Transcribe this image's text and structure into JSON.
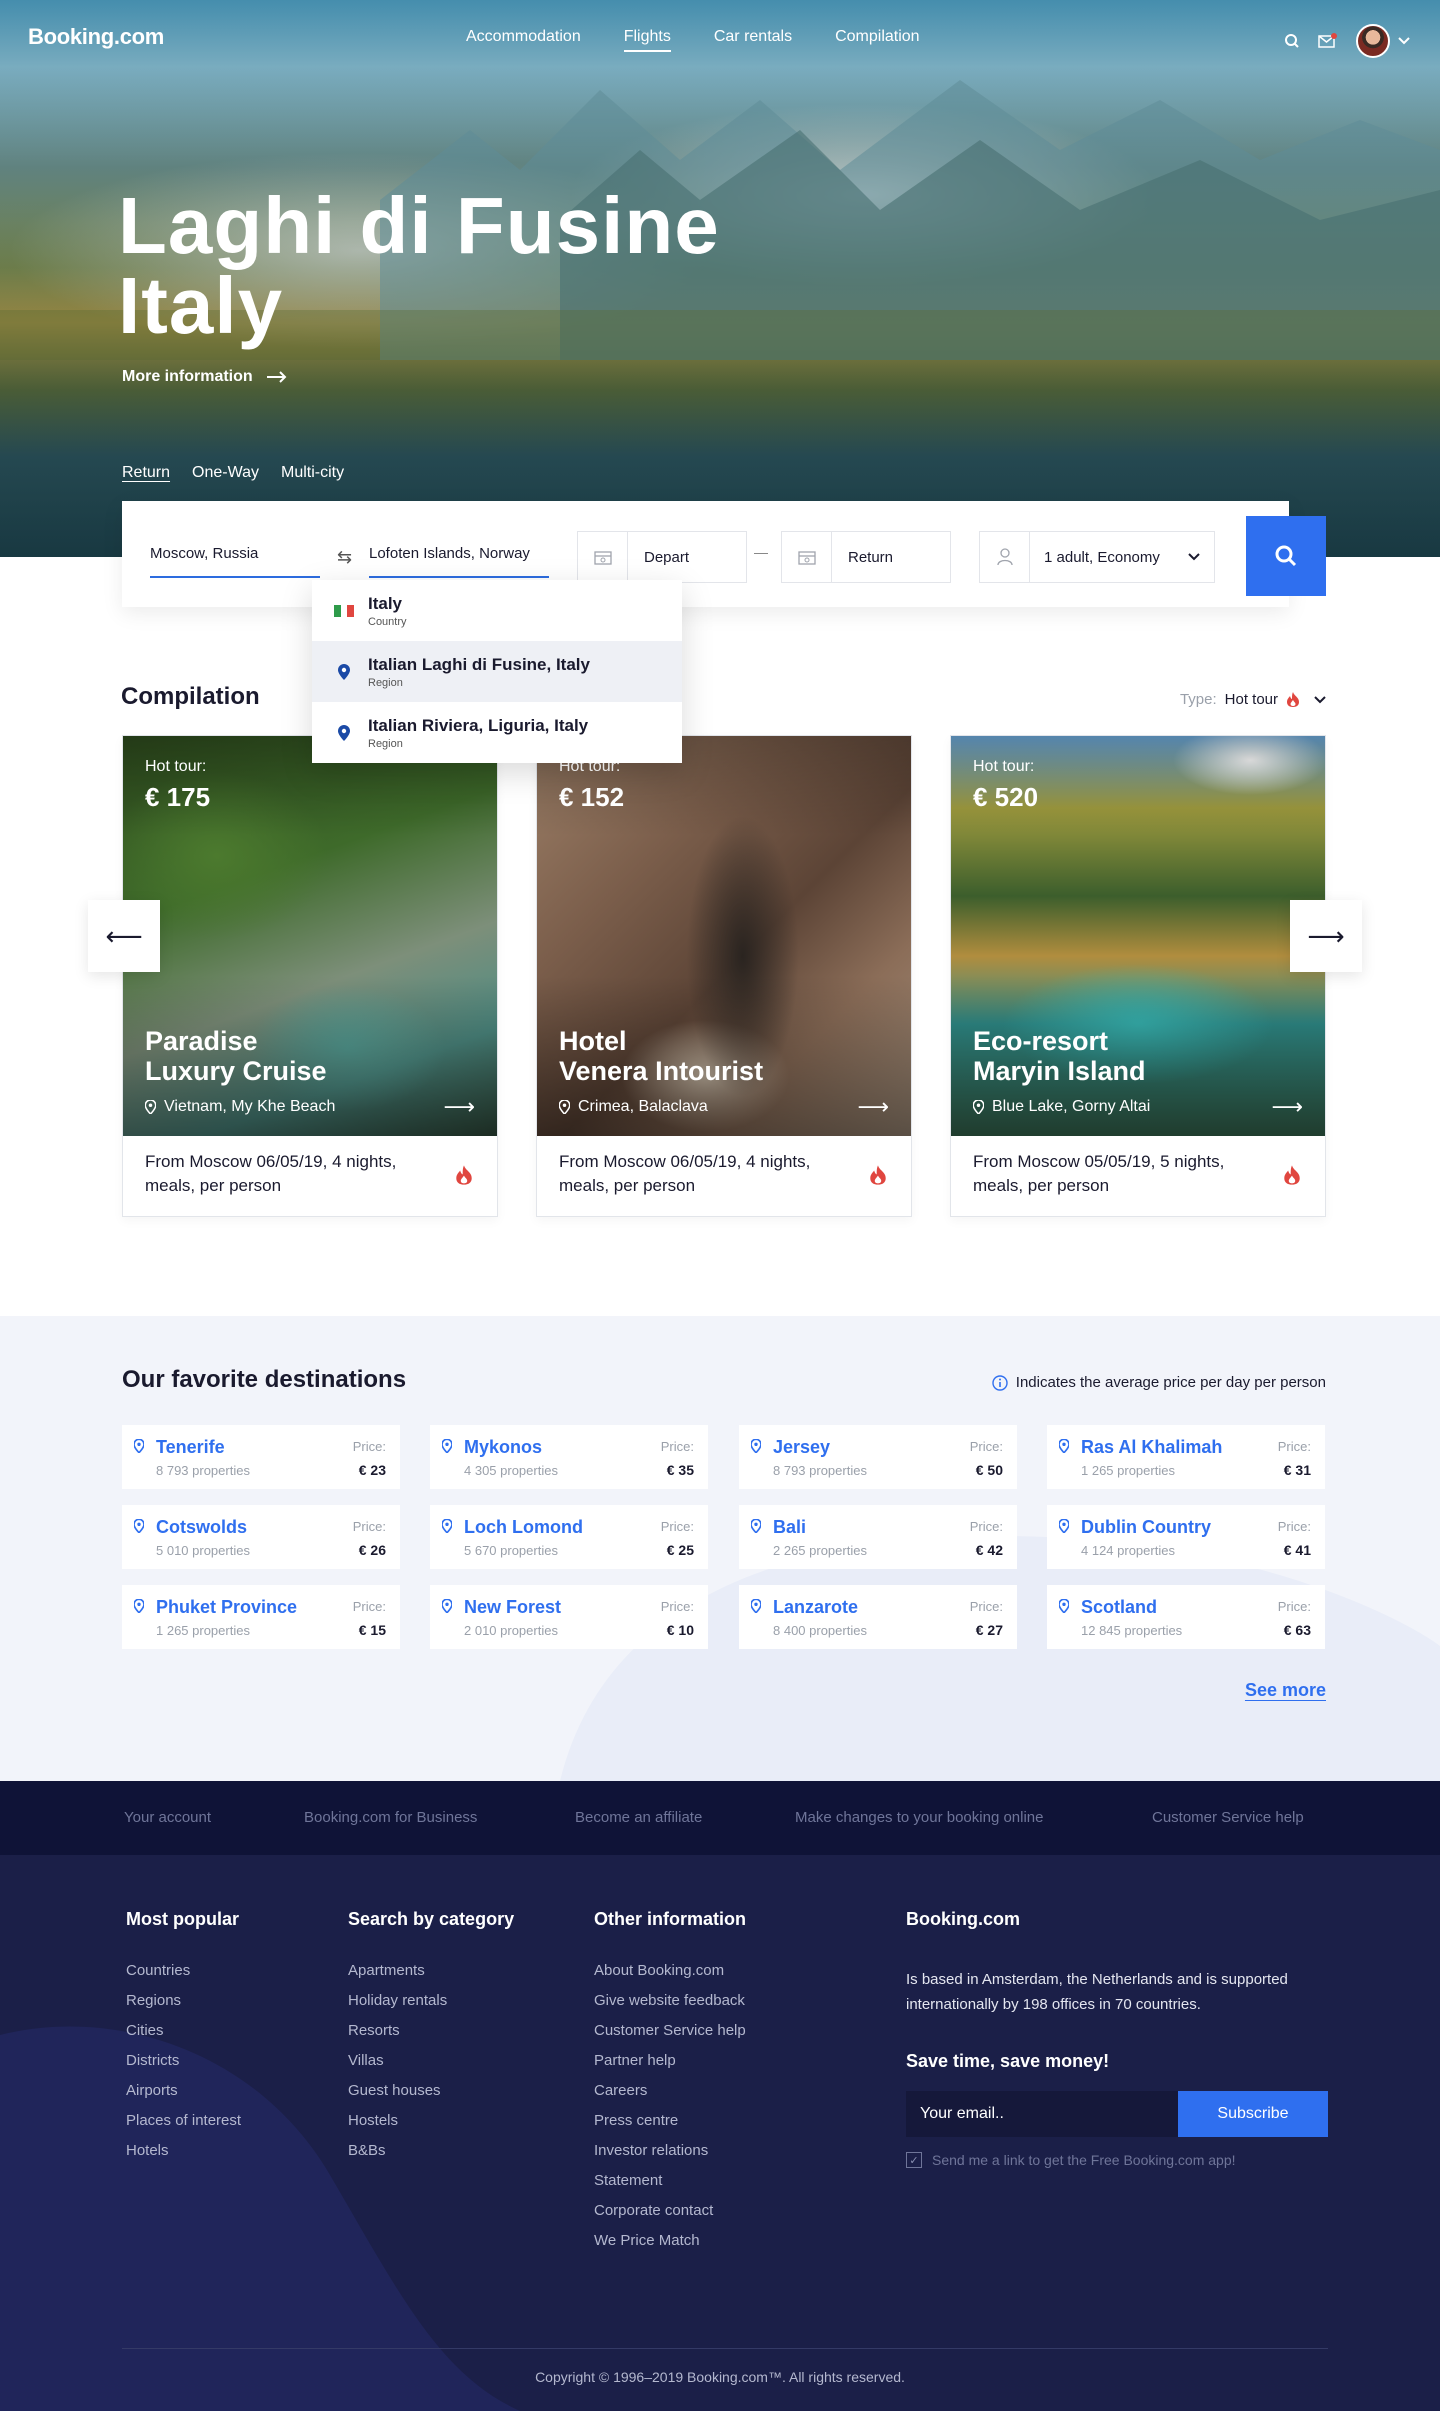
{
  "brand": "Booking.com",
  "nav": [
    "Accommodation",
    "Flights",
    "Car rentals",
    "Compilation"
  ],
  "hero": {
    "title_line1": "Laghi di Fusine",
    "title_line2": "Italy",
    "more_info": "More information"
  },
  "trip_types": [
    "Return",
    "One-Way",
    "Multi-city"
  ],
  "search": {
    "from": "Moscow, Russia",
    "to": "Lofoten Islands, Norway",
    "depart": "Depart",
    "return": "Return",
    "passengers": "1 adult, Economy"
  },
  "dropdown": [
    {
      "title": "Italy",
      "sub": "Country",
      "icon": "italy-flag"
    },
    {
      "title": "Italian Laghi di Fusine, Italy",
      "sub": "Region",
      "icon": "pin-icon"
    },
    {
      "title": "Italian Riviera, Liguria, Italy",
      "sub": "Region",
      "icon": "pin-icon"
    }
  ],
  "compilation": {
    "title": "Compilation",
    "type_label": "Type:",
    "type_value": "Hot tour",
    "cards": [
      {
        "hot": "Hot tour:",
        "price": "€ 175",
        "name_line1": "Paradise",
        "name_line2": "Luxury Cruise",
        "location": "Vietnam, My Khe Beach",
        "desc": "From Moscow 06/05/19, 4 nights, meals, per person"
      },
      {
        "hot": "Hot tour:",
        "price": "€ 152",
        "name_line1": "Hotel",
        "name_line2": "Venera Intourist",
        "location": "Crimea, Balaclava",
        "desc": "From Moscow 06/05/19, 4 nights, meals, per person"
      },
      {
        "hot": "Hot tour:",
        "price": "€ 520",
        "name_line1": "Eco-resort",
        "name_line2": "Maryin Island",
        "location": "Blue Lake, Gorny Altai",
        "desc": "From Moscow 05/05/19, 5 nights, meals, per person"
      }
    ]
  },
  "favorites": {
    "title": "Our favorite destinations",
    "note": "Indicates the average price per day per person",
    "price_label": "Price:",
    "items": [
      {
        "name": "Tenerife",
        "props": "8 793 properties",
        "price": "€ 23"
      },
      {
        "name": "Mykonos",
        "props": "4 305 properties",
        "price": "€ 35"
      },
      {
        "name": "Jersey",
        "props": "8 793 properties",
        "price": "€ 50"
      },
      {
        "name": "Ras Al Khalimah",
        "props": "1 265 properties",
        "price": "€ 31"
      },
      {
        "name": "Cotswolds",
        "props": "5 010 properties",
        "price": "€ 26"
      },
      {
        "name": "Loch Lomond",
        "props": "5 670 properties",
        "price": "€ 25"
      },
      {
        "name": "Bali",
        "props": "2 265 properties",
        "price": "€ 42"
      },
      {
        "name": "Dublin Country",
        "props": "4 124 properties",
        "price": "€ 41"
      },
      {
        "name": "Phuket Province",
        "props": "1 265 properties",
        "price": "€ 15"
      },
      {
        "name": "New Forest",
        "props": "2 010 properties",
        "price": "€ 10"
      },
      {
        "name": "Lanzarote",
        "props": "8 400 properties",
        "price": "€ 27"
      },
      {
        "name": "Scotland",
        "props": "12 845 properties",
        "price": "€ 63"
      }
    ],
    "see_more": "See more"
  },
  "footer_top": [
    "Your account",
    "Booking.com for Business",
    "Become an affiliate",
    "Make changes to your booking online",
    "Customer Service help"
  ],
  "footer": {
    "most_popular": {
      "title": "Most popular",
      "links": [
        "Countries",
        "Regions",
        "Cities",
        "Districts",
        "Airports",
        "Places of interest",
        "Hotels"
      ]
    },
    "by_category": {
      "title": "Search by category",
      "links": [
        "Apartments",
        "Holiday rentals",
        "Resorts",
        "Villas",
        "Guest houses",
        "Hostels",
        "B&Bs"
      ]
    },
    "other_info": {
      "title": "Other information",
      "links": [
        "About Booking.com",
        "Give website feedback",
        "Customer Service help",
        "Partner help",
        "Careers",
        "Press centre",
        "Investor relations",
        "Statement",
        "Corporate contact",
        "We Price Match"
      ]
    },
    "about_title": "Booking.com",
    "about_text": "Is based in Amsterdam, the Netherlands and is supported internationally by 198 offices in 70 countries.",
    "save_title": "Save time, save money!",
    "email_placeholder": "Your email..",
    "subscribe": "Subscribe",
    "app_check": "Send me a link to get the Free Booking.com app!",
    "copyright": "Copyright © 1996–2019 Booking.com™. All rights reserved."
  },
  "colors": {
    "accent": "#2f6fef",
    "footer_bg": "#1b1f48",
    "footer_top_bg": "#0f1337",
    "flame": "#e0463f"
  }
}
